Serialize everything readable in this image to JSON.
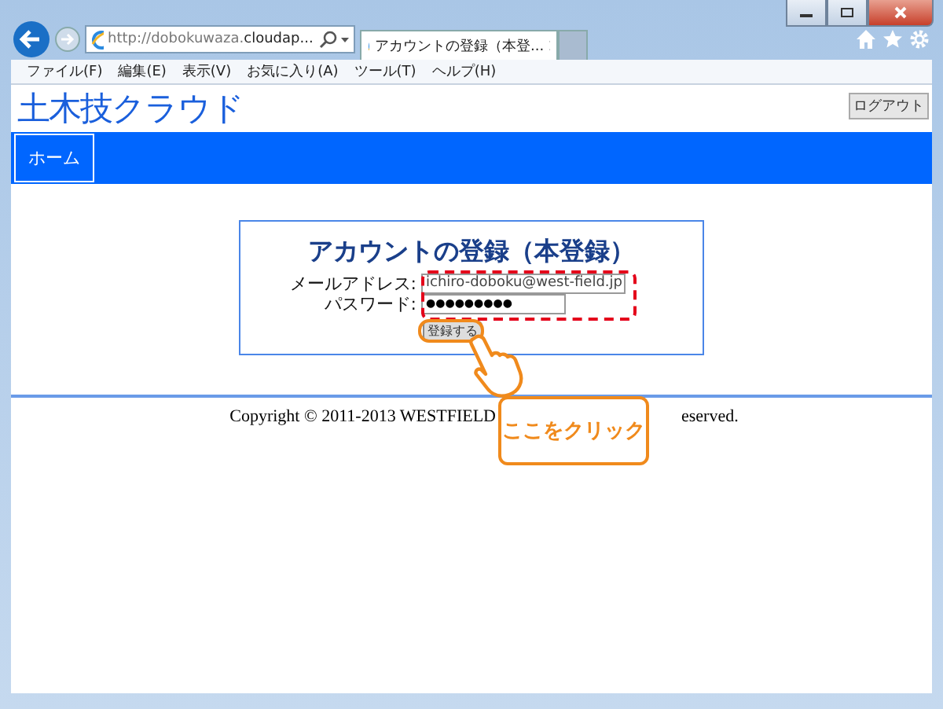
{
  "browser": {
    "address": "http://dobokuwaza.**cloudap...**",
    "tabs": [
      {
        "label": "アカウントの登録（本登...",
        "selected": true
      }
    ],
    "menu": [
      "ファイル(F)",
      "編集(E)",
      "表示(V)",
      "お気に入り(A)",
      "ツール(T)",
      "ヘルプ(H)"
    ]
  },
  "site": {
    "logo": "土木技クラウド",
    "logout": "ログアウト",
    "nav": [
      {
        "label": "ホーム",
        "selected": true
      }
    ]
  },
  "form": {
    "title": "アカウントの登録（本登録）",
    "fields": [
      {
        "kind": "text",
        "label": "メールアドレス:",
        "value": "ichiro-doboku@west-field.jp"
      },
      {
        "kind": "password",
        "label": "パスワード:",
        "value": "●●●●●●●●●"
      }
    ],
    "submit": "登録する"
  },
  "footer": [
    "Copyright © 2011-2013 WESTFIELD",
    "eserved."
  ],
  "annotation": {
    "callout": "ここをクリック"
  }
}
